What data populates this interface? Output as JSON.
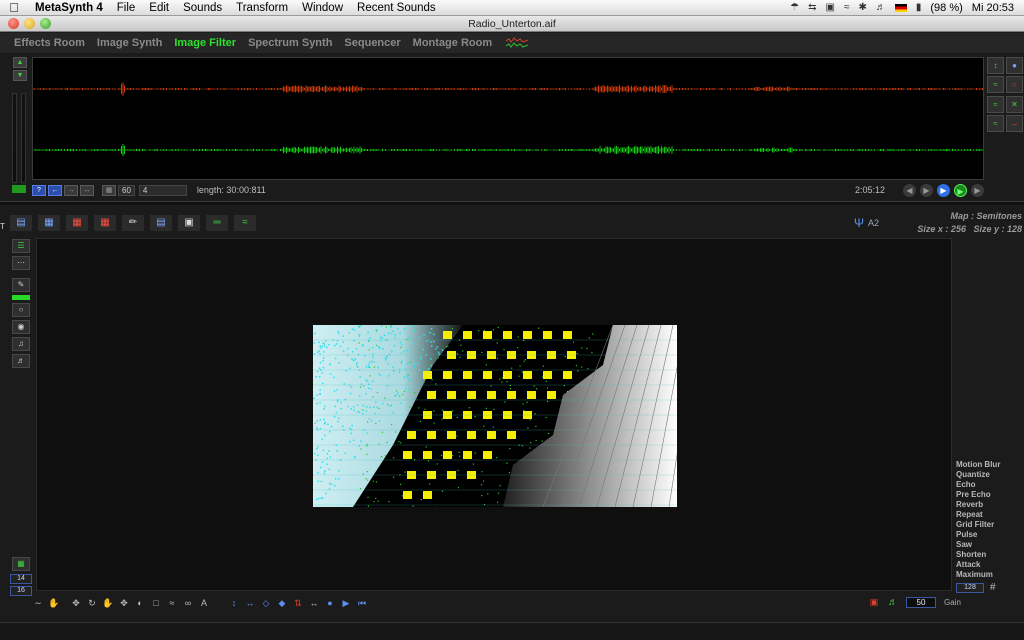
{
  "menubar": {
    "app_name": "MetaSynth 4",
    "items": [
      "File",
      "Edit",
      "Sounds",
      "Transform",
      "Window",
      "Recent Sounds"
    ],
    "battery": "(98 %)",
    "clock": "Mi 20:53"
  },
  "window": {
    "title": "Radio_Unterton.aif"
  },
  "rooms": {
    "tabs": [
      "Effects Room",
      "Image Synth",
      "Image Filter",
      "Spectrum Synth",
      "Sequencer",
      "Montage Room"
    ],
    "active": "Image Filter"
  },
  "waveform": {
    "top_color": "#ff4a10",
    "bottom_color": "#18ff18",
    "help_label": "?",
    "zoom_value": "60",
    "step_value": "4",
    "length": "length: 30:00:811",
    "time": "2:05:12"
  },
  "filter_toolbar": {
    "tuning": "A2",
    "map": "Map : Semitones",
    "size_x": "Size x : 256",
    "size_y": "Size y : 128"
  },
  "left_tools": {
    "marker": "T",
    "num_top": "14",
    "num_bottom": "16"
  },
  "filters": {
    "items": [
      "Motion Blur",
      "Quantize",
      "Echo",
      "Pre Echo",
      "Reverb",
      "Repeat",
      "Grid Filter",
      "Pulse",
      "Saw",
      "Shorten",
      "Attack",
      "Maximum"
    ],
    "count": "128"
  },
  "gain": {
    "value": "50",
    "label": "Gain"
  }
}
